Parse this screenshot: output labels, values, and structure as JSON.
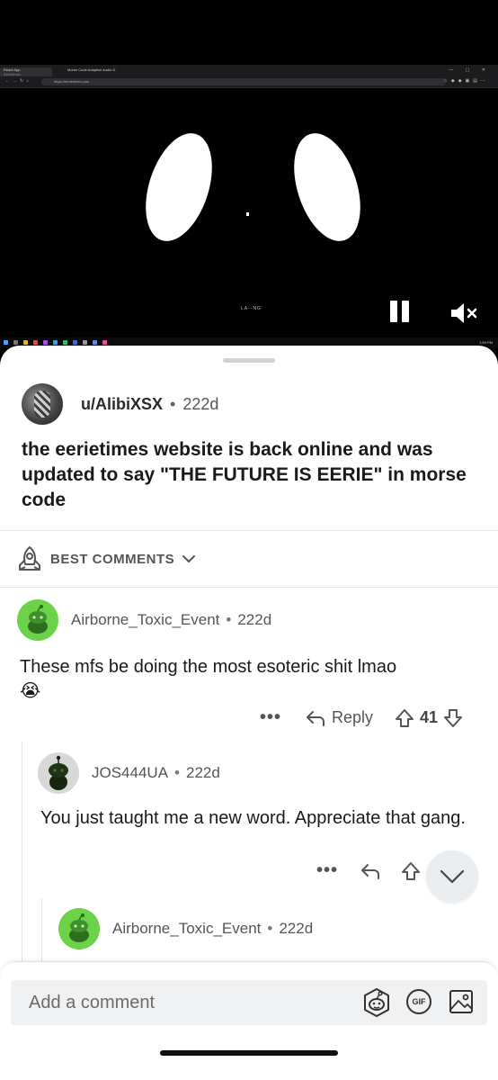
{
  "video": {
    "browser_tab_active": "React App",
    "browser_tab_subtitle": "Eerietimes",
    "browser_tab_inactive": "Morse Code Adaptive Audio D",
    "browser_url": "https://eerietimes.com",
    "caption": "LA--NG",
    "taskbar_time": "1:59 PM",
    "pause_label": "Pause",
    "mute_label": "Muted"
  },
  "post": {
    "username": "u/AlibiXSX",
    "age": "222d",
    "title": "the eerietimes website is back online and was updated to say \"THE FUTURE IS EERIE\" in morse code"
  },
  "sort": {
    "label": "BEST COMMENTS"
  },
  "comments": [
    {
      "username": "Airborne_Toxic_Event",
      "age": "222d",
      "body": "These mfs be doing the most esoteric shit lmao",
      "emoji": "😭",
      "more": "•••",
      "reply_label": "Reply",
      "votes": "41"
    },
    {
      "username": "JOS444UA",
      "age": "222d",
      "body": "You just taught me a new word. Appreciate that gang.",
      "more": "•••"
    },
    {
      "username": "Airborne_Toxic_Event",
      "age": "222d"
    }
  ],
  "composer": {
    "placeholder": "Add a comment",
    "gif_label": "GIF"
  },
  "colors": {
    "accent_green": "#6cd24a",
    "sheet_bg": "#ffffff",
    "video_bg": "#000000"
  },
  "icons": {
    "sort": "rocket-icon",
    "reply": "reply-arrow-icon",
    "upvote": "upvote-arrow-icon",
    "downvote": "downvote-arrow-icon",
    "emoji": "snoo-emoji-icon",
    "gif": "gif-icon",
    "image": "image-icon",
    "scroll": "chevron-down-icon"
  }
}
